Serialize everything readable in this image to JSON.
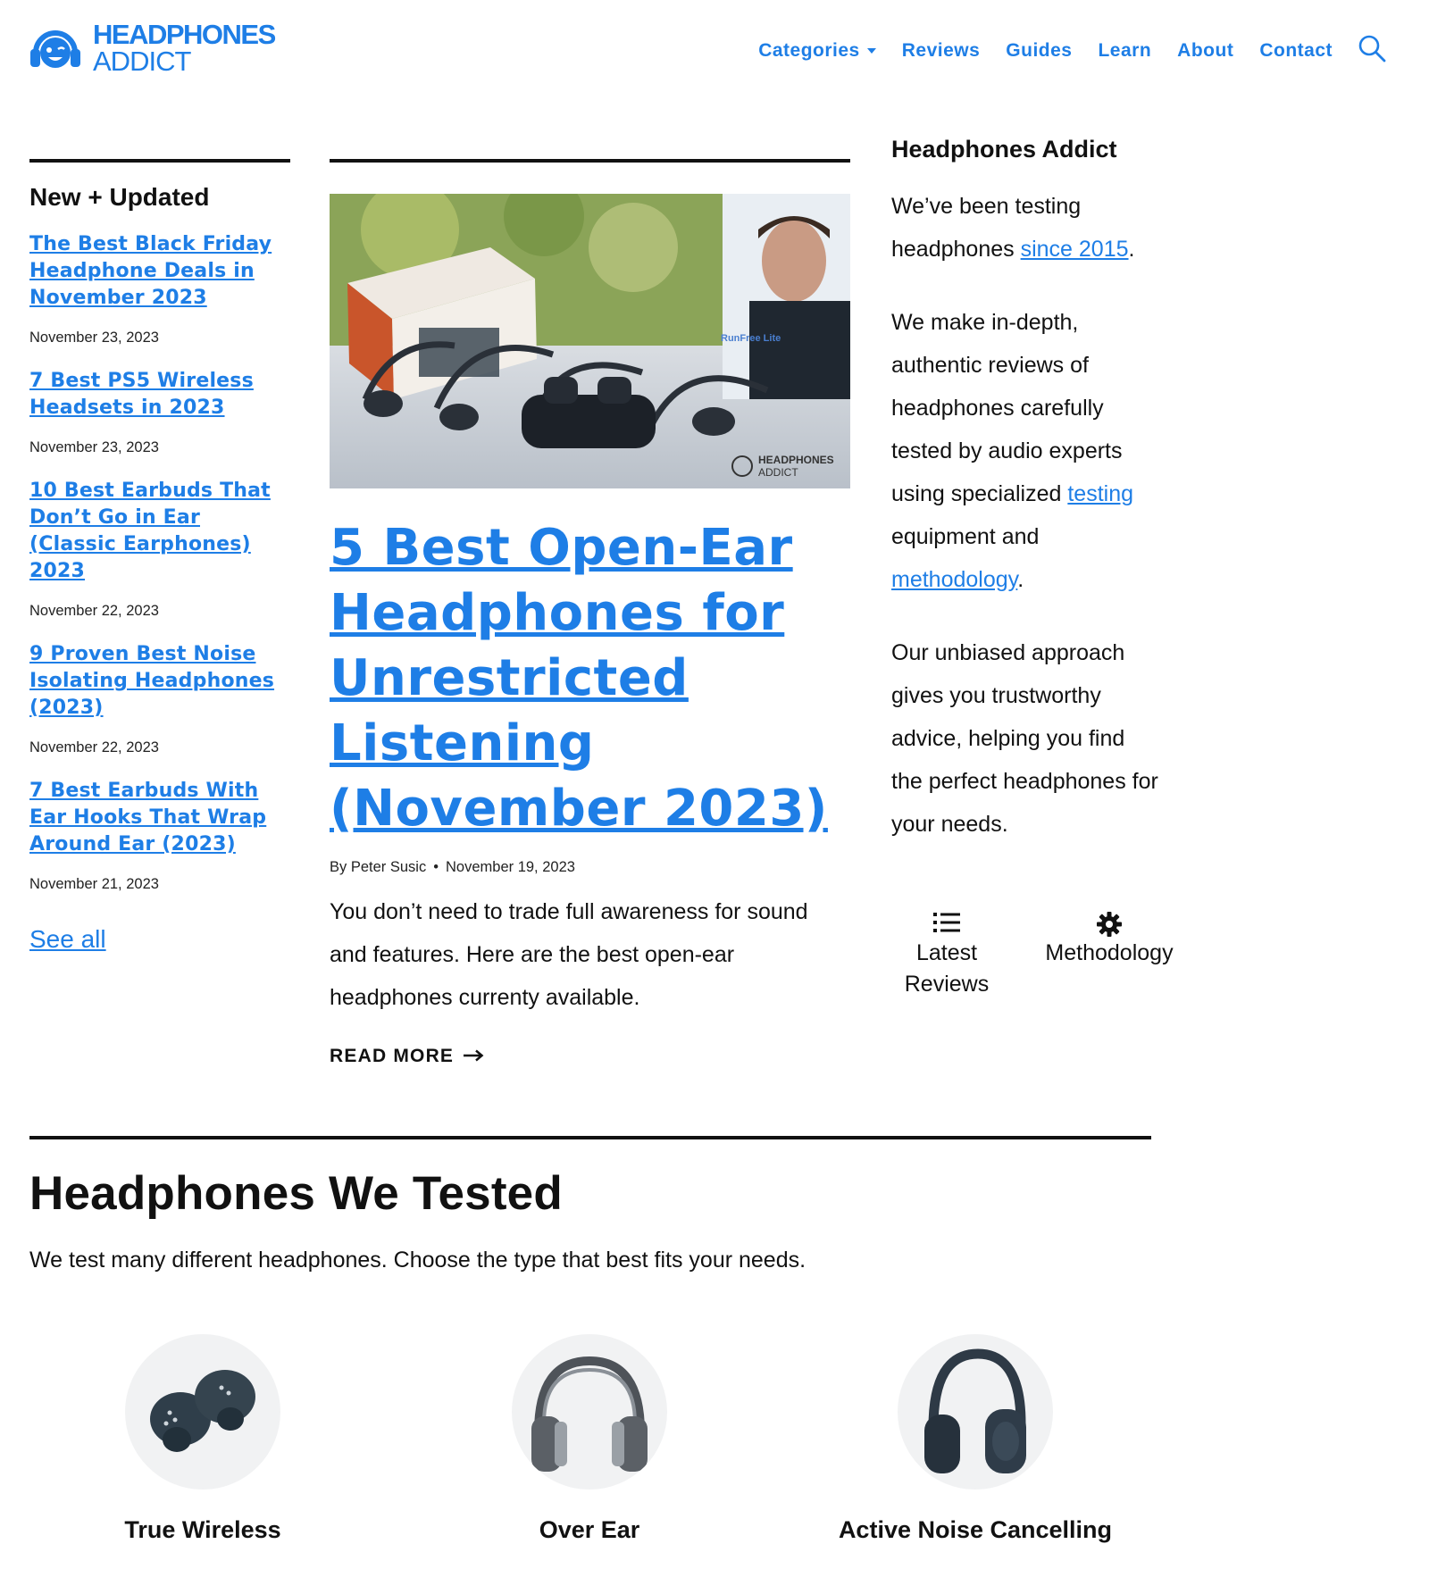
{
  "brand": {
    "line1": "HEADPHONES",
    "line2": "ADDICT",
    "color": "#1e7ee6"
  },
  "nav": {
    "items": [
      {
        "label": "Categories",
        "has_dropdown": true
      },
      {
        "label": "Reviews"
      },
      {
        "label": "Guides"
      },
      {
        "label": "Learn"
      },
      {
        "label": "About"
      },
      {
        "label": "Contact"
      }
    ],
    "search_icon": "search-icon"
  },
  "left": {
    "title": "New + Updated",
    "posts": [
      {
        "title": "The Best Black Friday Headphone Deals in November 2023",
        "date": "November 23, 2023"
      },
      {
        "title": "7 Best PS5 Wireless Headsets in 2023",
        "date": "November 23, 2023"
      },
      {
        "title": "10 Best Earbuds That Don’t Go in Ear (Classic Earphones) 2023",
        "date": "November 22, 2023"
      },
      {
        "title": "9 Proven Best Noise Isolating Headphones (2023)",
        "date": "November 22, 2023"
      },
      {
        "title": "7 Best Earbuds With Ear Hooks That Wrap Around Ear (2023)",
        "date": "November 21, 2023"
      }
    ],
    "see_all": "See all"
  },
  "featured": {
    "image_watermark_1": "HEADPHONES",
    "image_watermark_2": "ADDICT",
    "image_box_text": "RunFree Lite",
    "title": "5 Best Open-Ear Headphones for Unrestricted Listening (November 2023)",
    "author": "By Peter Susic",
    "separator": "•",
    "date": "November 19, 2023",
    "excerpt": "You don’t need to trade full awareness for sound and features. Here are the best open-ear headphones currenty available.",
    "read_more": "READ MORE",
    "read_more_icon": "arrow-right-icon"
  },
  "sidebar": {
    "title": "Headphones Addict",
    "p1_pre": "We’ve been testing headphones ",
    "p1_link": "since 2015",
    "p1_post": ".",
    "p2_pre": "We make in-depth, authentic reviews of headphones carefully tested by audio experts using specialized ",
    "p2_link1": "testing",
    "p2_mid": " equipment and ",
    "p2_link2": "methodology",
    "p2_post": ".",
    "p3": "Our unbiased approach gives you trustworthy advice, helping you find the perfect headphones for your needs.",
    "quick_links": [
      {
        "label": "Latest Reviews",
        "icon": "list-icon"
      },
      {
        "label": "Methodology",
        "icon": "gear-icon"
      }
    ]
  },
  "tested": {
    "title": "Headphones We Tested",
    "subtitle": "We test many different headphones. Choose the type that best fits your needs.",
    "types": [
      {
        "label": "True Wireless",
        "icon": "earbuds-icon"
      },
      {
        "label": "Over Ear",
        "icon": "over-ear-headphones-icon"
      },
      {
        "label": "Active Noise Cancelling",
        "icon": "anc-headphones-icon"
      }
    ]
  }
}
